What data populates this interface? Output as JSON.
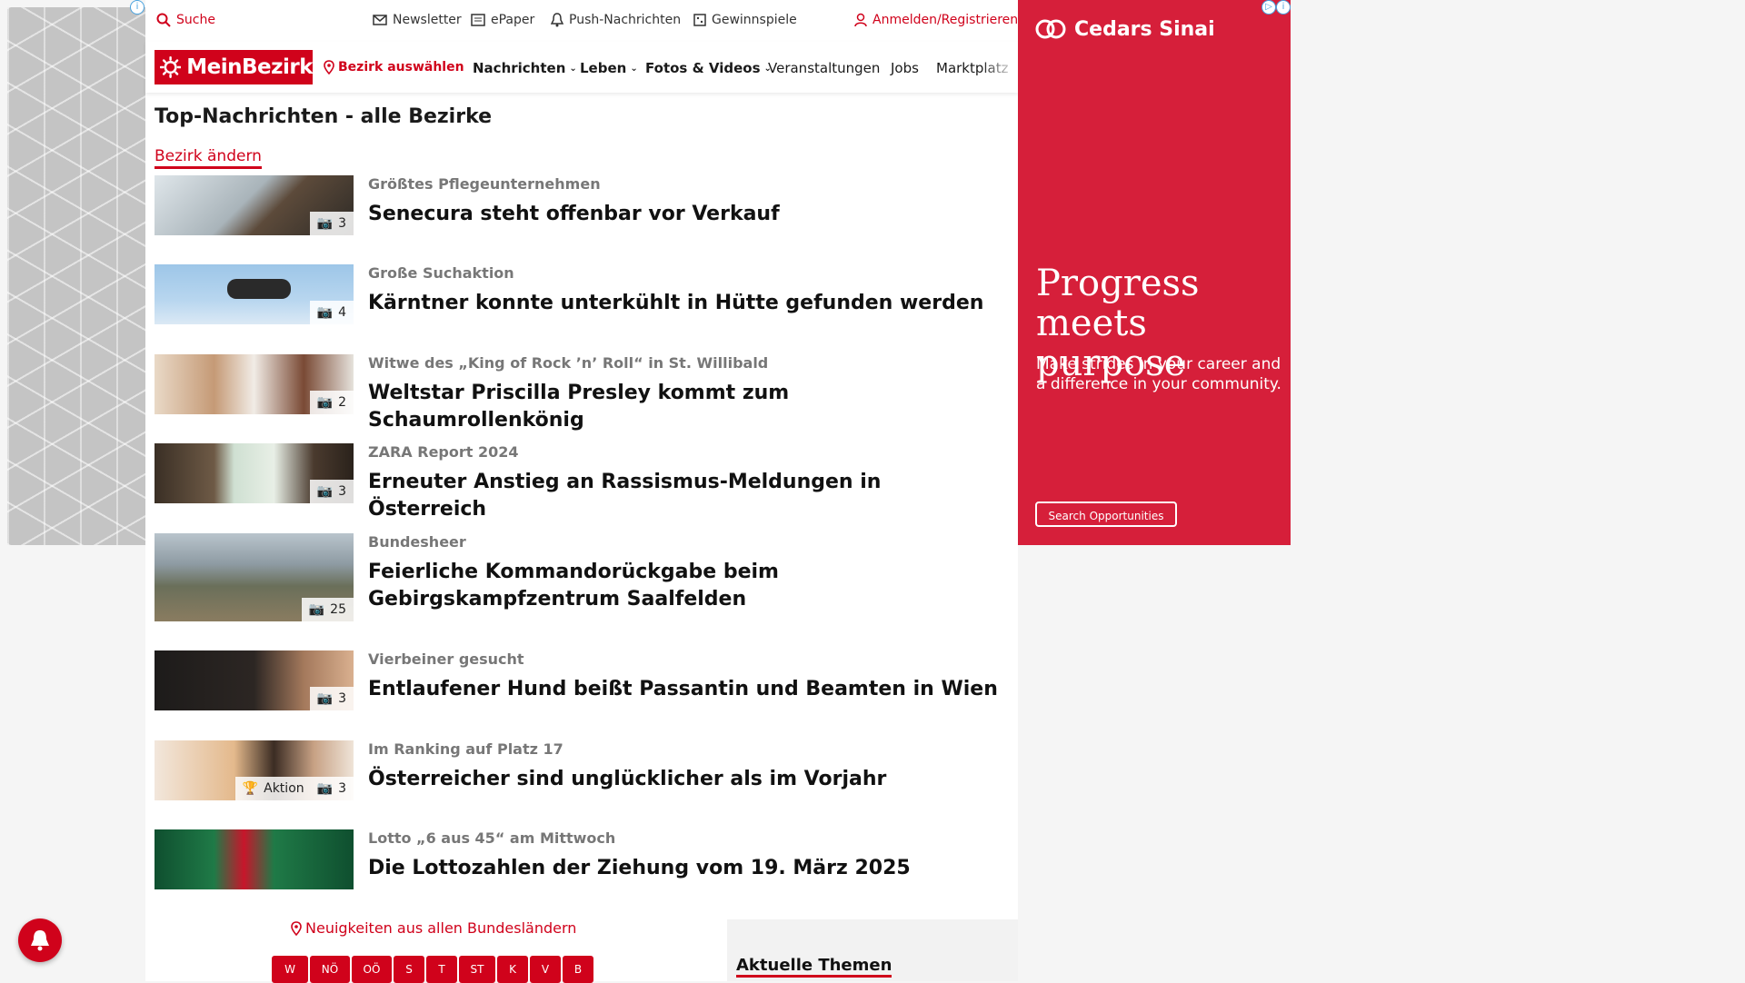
{
  "utility": {
    "search_label": "Suche",
    "newsletter_label": "Newsletter",
    "epaper_label": "ePaper",
    "push_label": "Push-Nachrichten",
    "games_label": "Gewinnspiele",
    "login_label": "Anmelden/Registrieren"
  },
  "nav": {
    "logo_text": "MeinBezirk",
    "district_select": "Bezirk auswählen",
    "items": [
      "Nachrichten",
      "Leben",
      "Fotos & Videos",
      "Veranstaltungen",
      "Jobs",
      "Marktplatz"
    ]
  },
  "section": {
    "title": "Top-Nachrichten - alle Bezirke",
    "change_label": "Bezirk ändern"
  },
  "articles": [
    {
      "kicker": "Größtes Pflegeunternehmen",
      "headline": "Senecura steht offenbar vor Verkauf",
      "photo_count": "3"
    },
    {
      "kicker": "Große Suchaktion",
      "headline": "Kärntner konnte unterkühlt in Hütte gefunden werden",
      "photo_count": "4"
    },
    {
      "kicker": "Witwe des „King of Rock ’n’ Roll“ in St. Willibald",
      "headline": "Weltstar Priscilla Presley kommt zum Schaumrollenkönig",
      "photo_count": "2"
    },
    {
      "kicker": "ZARA Report 2024",
      "headline": "Erneuter Anstieg an Rassismus-Meldungen in Österreich",
      "photo_count": "3"
    },
    {
      "kicker": "Bundesheer",
      "headline": "Feierliche Kommandorückgabe beim Gebirgskampfzentrum Saalfelden",
      "photo_count": "25"
    },
    {
      "kicker": "Vierbeiner gesucht",
      "headline": "Entlaufener Hund beißt Passantin und Beamten in Wien",
      "photo_count": "3"
    },
    {
      "kicker": "Im Ranking auf Platz 17",
      "headline": "Österreicher sind unglücklicher als im Vorjahr",
      "photo_count": "3",
      "extra_badge": "Aktion"
    },
    {
      "kicker": "Lotto „6 aus 45“ am Mittwoch",
      "headline": "Die Lottozahlen der Ziehung vom 19. März 2025",
      "photo_count": ""
    }
  ],
  "bottom": {
    "all_states_label": "Neuigkeiten aus allen Bundesländern",
    "states": [
      "W",
      "NÖ",
      "OÖ",
      "S",
      "T",
      "ST",
      "K",
      "V",
      "B"
    ],
    "themes_title": "Aktuelle Themen"
  },
  "ad": {
    "brand": "Cedars Sinai",
    "title": "Progress meets purpose",
    "subtitle": "Make strides in your career and a difference in your community.",
    "cta": "Search Opportunities"
  },
  "colors": {
    "brand_red": "#d0021b",
    "ad_red": "#d61f3a"
  }
}
